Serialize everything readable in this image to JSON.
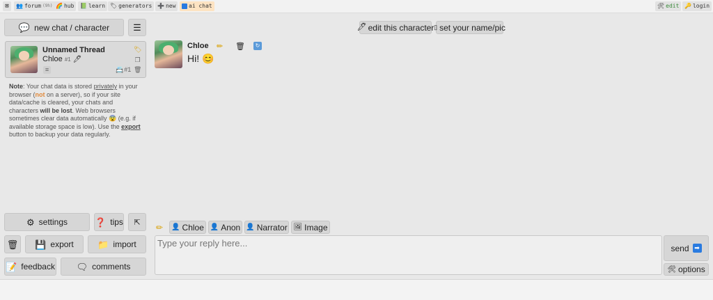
{
  "topnav": {
    "left": [
      {
        "label": "",
        "icon": "close-icon",
        "color": "#555"
      },
      {
        "label": "forum",
        "badge": "(9h)",
        "icon": "users-icon",
        "color": "#555"
      },
      {
        "label": "hub",
        "icon": "rainbow-icon",
        "color": "#e05a5a"
      },
      {
        "label": "learn",
        "icon": "book-icon",
        "color": "#3a8a3a"
      },
      {
        "label": "generators",
        "icon": "tag-icon",
        "color": "#555"
      },
      {
        "label": "new",
        "icon": "plus-icon",
        "color": "#555"
      },
      {
        "label": "ai chat",
        "icon": "chat-icon",
        "color": "#2a7be0"
      }
    ],
    "right": [
      {
        "label": "edit",
        "icon": "pencil-icon",
        "color": "#3a8a3a"
      },
      {
        "label": "login",
        "icon": "key-icon",
        "color": "#d9a000"
      }
    ]
  },
  "sidebar": {
    "new_chat_label": "new chat / character",
    "menu_label": "☰",
    "thread": {
      "title": "Unnamed Thread",
      "character": "Chloe",
      "character_num": "#1",
      "count": "#1"
    },
    "note": {
      "prefix": "Note",
      "part1": ": Your chat data is stored ",
      "privately": "privately",
      "part2": " in your browser (",
      "not": "not",
      "part3": " on a server), so if your site data/cache is cleared, your chats and characters ",
      "will_be_lost": "will be lost",
      "part4": ". Web browsers sometimes clear data automatically 😨 (e.g. if available storage space is low). Use the ",
      "export": "export",
      "part5": " button to backup your data regularly."
    },
    "buttons": {
      "settings": "settings",
      "tips": "tips",
      "collapse": "⇱",
      "export": "export",
      "import": "import",
      "feedback": "feedback",
      "comments": "comments"
    }
  },
  "header": {
    "edit_character": "edit this character",
    "set_name": "set your name/pic"
  },
  "messages": [
    {
      "author": "Chloe",
      "text": "Hi! 😊"
    }
  ],
  "composer": {
    "speakers": [
      "Chloe",
      "Anon",
      "Narrator",
      "Image"
    ],
    "placeholder": "Type your reply here...",
    "send": "send",
    "options": "options"
  }
}
